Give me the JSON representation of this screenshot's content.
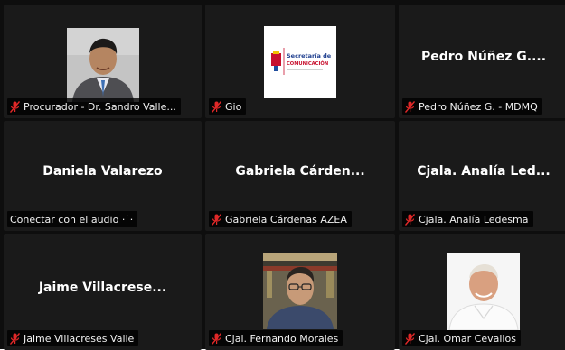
{
  "tiles": [
    {
      "id": "sandro",
      "big_name": "",
      "label": "Procurador - Dr. Sandro Valle...",
      "muted": true,
      "photo": "person-photo"
    },
    {
      "id": "gio",
      "big_name": "",
      "label": "Gio",
      "muted": true,
      "photo": "logo-photo",
      "logo_text": [
        "Secretaría de",
        "COMUNICACIÓN"
      ]
    },
    {
      "id": "pedro",
      "big_name": "Pedro Núñez G....",
      "label": "Pedro Núñez G. - MDMQ",
      "muted": true
    },
    {
      "id": "daniela",
      "big_name": "Daniela Valarezo",
      "label": "Conectar con el audio ·˙·",
      "muted": false
    },
    {
      "id": "gabriela",
      "big_name": "Gabriela  Cárden...",
      "label": "Gabriela Cárdenas AZEA",
      "muted": true
    },
    {
      "id": "analia",
      "big_name": "Cjala. Analía Led...",
      "label": "Cjala. Analía Ledesma",
      "muted": true
    },
    {
      "id": "jaime",
      "big_name": "Jaime  Villacrese...",
      "label": "Jaime Villacreses Valle",
      "muted": true
    },
    {
      "id": "fernando",
      "big_name": "",
      "label": "Cjal. Fernando Morales",
      "muted": true,
      "photo": "person-photo"
    },
    {
      "id": "omar",
      "big_name": "",
      "label": "Cjal. Omar Cevallos",
      "muted": true,
      "photo": "person-photo"
    }
  ],
  "colors": {
    "background": "#0e0e0e",
    "tile": "#1a1a1a",
    "muted_icon": "#e02828",
    "label_bg": "#000000"
  },
  "icons": {
    "muted": "mic-muted-icon"
  }
}
